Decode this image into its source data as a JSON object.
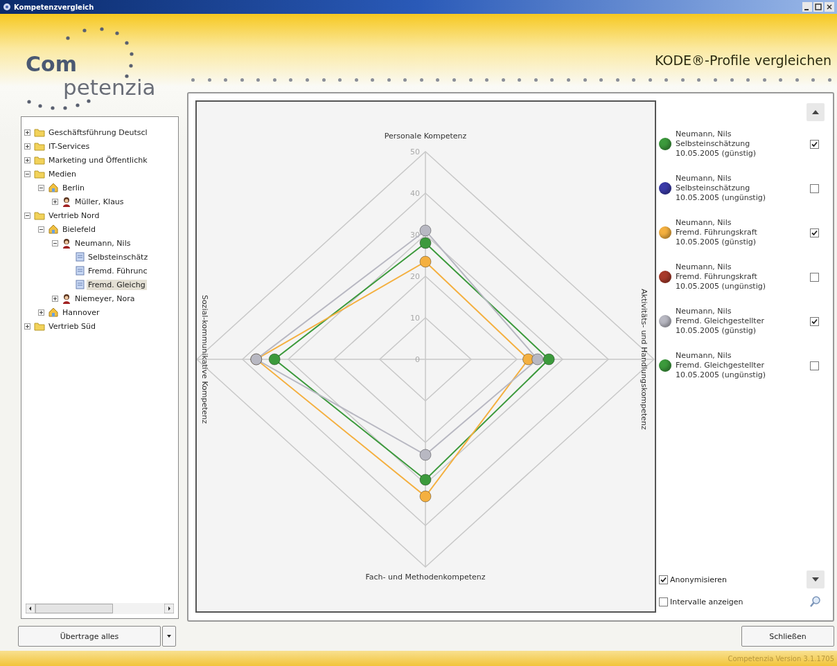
{
  "window": {
    "title": "Kompetenzvergleich"
  },
  "logo": {
    "line_1": "Com",
    "line_2": "petenzia"
  },
  "header": {
    "title": "KODE®-Profile vergleichen"
  },
  "tree": [
    {
      "label": "Geschäftsführung Deutscl",
      "kind": "folder",
      "expanded": false,
      "selected": false
    },
    {
      "label": "IT-Services",
      "kind": "folder",
      "expanded": false,
      "selected": false
    },
    {
      "label": "Marketing und Öffentlichk",
      "kind": "folder",
      "expanded": false,
      "selected": false
    },
    {
      "label": "Medien",
      "kind": "folder",
      "expanded": true,
      "selected": false,
      "children": [
        {
          "label": "Berlin",
          "kind": "location",
          "expanded": true,
          "selected": false,
          "children": [
            {
              "label": "Müller, Klaus",
              "kind": "person",
              "expanded": false,
              "selected": false
            }
          ]
        }
      ]
    },
    {
      "label": "Vertrieb Nord",
      "kind": "folder",
      "expanded": true,
      "selected": false,
      "children": [
        {
          "label": "Bielefeld",
          "kind": "location",
          "expanded": true,
          "selected": false,
          "children": [
            {
              "label": "Neumann, Nils",
              "kind": "person",
              "expanded": true,
              "selected": false,
              "children": [
                {
                  "label": "Selbsteinschätz",
                  "kind": "document",
                  "selected": false
                },
                {
                  "label": "Fremd. Führunc",
                  "kind": "document",
                  "selected": false
                },
                {
                  "label": "Fremd. Gleichg",
                  "kind": "document",
                  "selected": true
                }
              ]
            },
            {
              "label": "Niemeyer, Nora",
              "kind": "person",
              "expanded": false,
              "selected": false
            }
          ]
        },
        {
          "label": "Hannover",
          "kind": "location",
          "expanded": false,
          "selected": false
        }
      ]
    },
    {
      "label": "Vertrieb Süd",
      "kind": "folder",
      "expanded": false,
      "selected": false
    }
  ],
  "chart": {
    "axis_labels": [
      "Personale Kompetenz",
      "Aktivitäts- und Handlungskompetenz",
      "Fach- und Methodenkompetenz",
      "Sozial-kommunikative Kompetenz"
    ],
    "ticks": [
      "50",
      "40",
      "30",
      "20",
      "10",
      "0"
    ]
  },
  "legend": [
    {
      "name": "Neumann, Nils",
      "type": "Selbsteinschätzung",
      "date": "10.05.2005 (günstig)",
      "color": "#3c9a3c",
      "checked": true
    },
    {
      "name": "Neumann, Nils",
      "type": "Selbsteinschätzung",
      "date": "10.05.2005 (ungünstig)",
      "color": "#3a3aa8",
      "checked": false
    },
    {
      "name": "Neumann, Nils",
      "type": "Fremd. Führungskraft",
      "date": "10.05.2005 (günstig)",
      "color": "#f4b040",
      "checked": true
    },
    {
      "name": "Neumann, Nils",
      "type": "Fremd. Führungskraft",
      "date": "10.05.2005 (ungünstig)",
      "color": "#a83a2a",
      "checked": false
    },
    {
      "name": "Neumann, Nils",
      "type": "Fremd. Gleichgestellter",
      "date": "10.05.2005 (günstig)",
      "color": "#b8b8c2",
      "checked": true
    },
    {
      "name": "Neumann, Nils",
      "type": "Fremd. Gleichgestellter",
      "date": "10.05.2005 (ungünstig)",
      "color": "#3c9a3c",
      "checked": false
    }
  ],
  "options": [
    {
      "label": "Anonymisieren",
      "checked": true
    },
    {
      "label": "Intervalle anzeigen",
      "checked": false
    }
  ],
  "buttons": {
    "transfer": "Übertrage alles",
    "close": "Schließen"
  },
  "status_bar": {
    "version": "Competenzia Version 3.1.1705"
  }
}
